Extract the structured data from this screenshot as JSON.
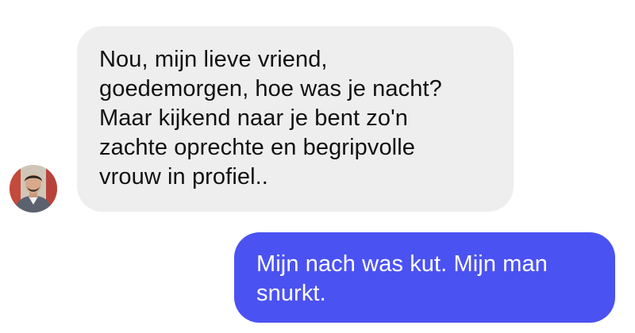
{
  "conversation": {
    "incoming": {
      "lines": [
        "Nou, mijn lieve vriend,",
        "goedemorgen, hoe was je nacht?",
        "Maar kijkend naar je bent zo'n",
        "zachte oprechte en begripvolle",
        "vrouw in profiel.."
      ],
      "avatar_icon": "contact-avatar"
    },
    "outgoing": {
      "lines": [
        "Mijn nach was kut. Mijn man",
        "snurkt."
      ]
    }
  },
  "colors": {
    "incoming_bubble": "#eeeeef",
    "outgoing_bubble": "#4b52f2",
    "outgoing_text": "#ffffff",
    "incoming_text": "#111111"
  }
}
